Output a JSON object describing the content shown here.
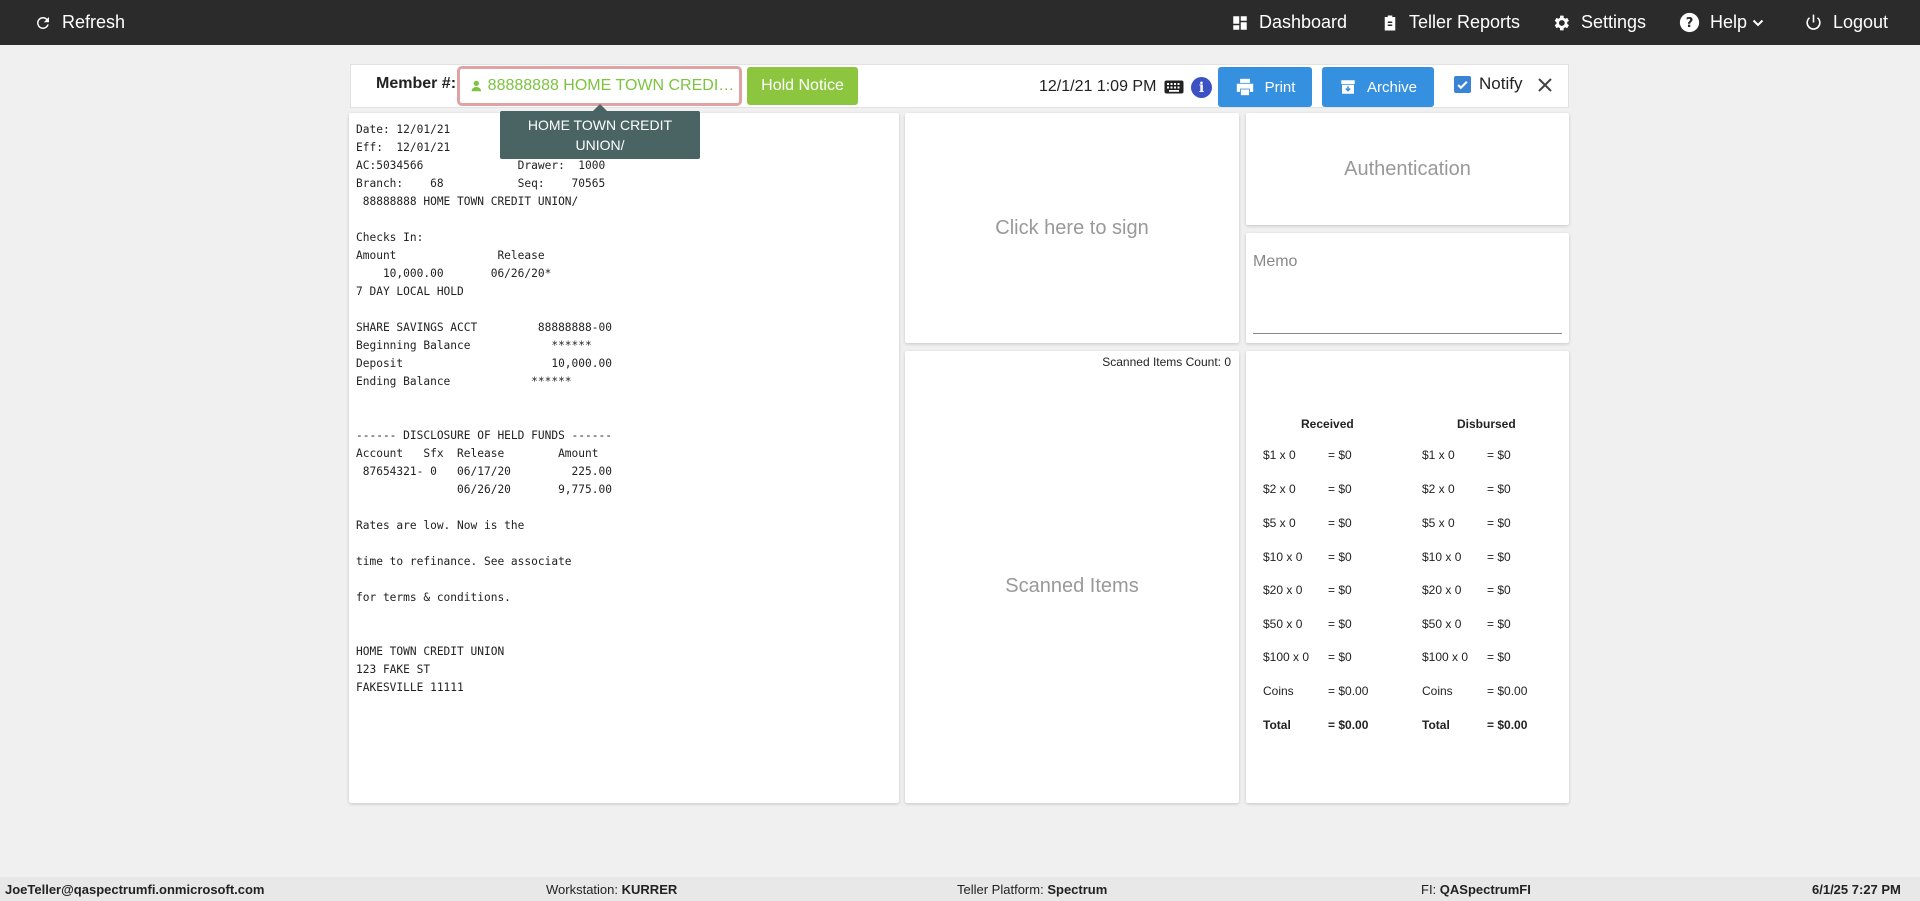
{
  "nav": {
    "refresh": "Refresh",
    "dashboard": "Dashboard",
    "teller_reports": "Teller Reports",
    "settings": "Settings",
    "help": "Help",
    "logout": "Logout"
  },
  "toolbar": {
    "member_label": "Member #:",
    "member_value": "88888888 HOME TOWN CREDIT ...",
    "hold_notice": "Hold Notice",
    "datetime": "12/1/21 1:09 PM",
    "info": "i",
    "print": "Print",
    "archive": "Archive",
    "notify": "Notify"
  },
  "tooltip": {
    "line1": "HOME TOWN CREDIT",
    "line2": "UNION/"
  },
  "receipt": {
    "text": "Date: 12/01/21\nEff:  12/01/21\nAC:5034566              Drawer:  1000\nBranch:    68           Seq:    70565\n 88888888 HOME TOWN CREDIT UNION/\n\nChecks In:\nAmount               Release\n    10,000.00       06/26/20*\n7 DAY LOCAL HOLD\n\nSHARE SAVINGS ACCT         88888888-00\nBeginning Balance            ******\nDeposit                      10,000.00\nEnding Balance            ******\n\n\n------ DISCLOSURE OF HELD FUNDS ------\nAccount   Sfx  Release        Amount\n 87654321- 0   06/17/20         225.00\n               06/26/20       9,775.00\n\nRates are low. Now is the\n\ntime to refinance. See associate\n\nfor terms & conditions.\n\n\nHOME TOWN CREDIT UNION\n123 FAKE ST\nFAKESVILLE 11111"
  },
  "panels": {
    "sign": "Click here to sign",
    "authentication": "Authentication",
    "memo": "Memo",
    "scanned_count": "Scanned Items Count: 0",
    "scanned_title": "Scanned Items"
  },
  "cash": {
    "received_header": "Received",
    "disbursed_header": "Disbursed",
    "received": [
      {
        "denom": "$1 x 0",
        "value": "= $0"
      },
      {
        "denom": "$2 x 0",
        "value": "= $0"
      },
      {
        "denom": "$5 x 0",
        "value": "= $0"
      },
      {
        "denom": "$10 x 0",
        "value": "= $0"
      },
      {
        "denom": "$20 x 0",
        "value": "= $0"
      },
      {
        "denom": "$50 x 0",
        "value": "= $0"
      },
      {
        "denom": "$100 x 0",
        "value": "= $0"
      },
      {
        "denom": "Coins",
        "value": "= $0.00"
      },
      {
        "denom": "Total",
        "value": "= $0.00"
      }
    ],
    "disbursed": [
      {
        "denom": "$1 x 0",
        "value": "= $0"
      },
      {
        "denom": "$2 x 0",
        "value": "= $0"
      },
      {
        "denom": "$5 x 0",
        "value": "= $0"
      },
      {
        "denom": "$10 x 0",
        "value": "= $0"
      },
      {
        "denom": "$20 x 0",
        "value": "= $0"
      },
      {
        "denom": "$50 x 0",
        "value": "= $0"
      },
      {
        "denom": "$100 x 0",
        "value": "= $0"
      },
      {
        "denom": "Coins",
        "value": "= $0.00"
      },
      {
        "denom": "Total",
        "value": "= $0.00"
      }
    ]
  },
  "footer": {
    "user": "JoeTeller@qaspectrumfi.onmicrosoft.com",
    "workstation_label": "Workstation:",
    "workstation": "KURRER",
    "platform_label": "Teller Platform:",
    "platform": "Spectrum",
    "fi_label": "FI:",
    "fi": "QASpectrumFI",
    "datetime": "6/1/25 7:27 PM"
  },
  "colors": {
    "navbar": "#2b2b2b",
    "member_green": "#7cc43f",
    "hold_green": "#8cc63f",
    "button_blue": "#3590e0",
    "tooltip": "#4a6363"
  }
}
